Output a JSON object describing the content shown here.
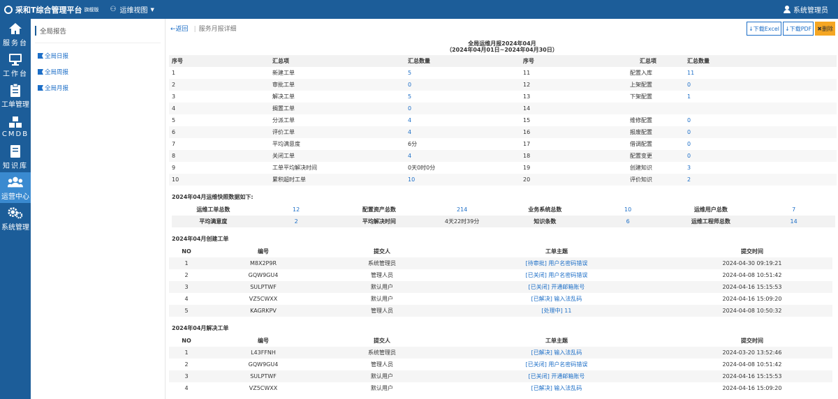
{
  "header": {
    "logo": "采和T综合管理平台",
    "logo_sub": "旗舰版",
    "view": "运维视图",
    "user": "系统管理员",
    "colors": {
      "primary": "#1c5d99",
      "active": "#3a8ad0",
      "link": "#1c6ec7",
      "delete": "#f5a623"
    }
  },
  "nav": [
    {
      "label": "服务台",
      "icon": "home-icon"
    },
    {
      "label": "工作台",
      "icon": "monitor-icon"
    },
    {
      "label": "工单管理",
      "icon": "clipboard-icon"
    },
    {
      "label": "CMDB",
      "icon": "cubes-icon"
    },
    {
      "label": "知识库",
      "icon": "book-icon"
    },
    {
      "label": "运营中心",
      "icon": "users-icon",
      "active": true
    },
    {
      "label": "系统管理",
      "icon": "gears-icon"
    }
  ],
  "sidebar": {
    "title": "全局报告",
    "items": [
      {
        "label": "全局日报"
      },
      {
        "label": "全局周报"
      },
      {
        "label": "全局月报"
      }
    ]
  },
  "toolbar": {
    "back": "返回",
    "crumb": "服务月报详细",
    "excel": "下载Excel",
    "pdf": "下载PDF",
    "delete": "删除"
  },
  "report": {
    "title": "全局运维月报2024年04月",
    "range": "（2024年04月01日~2024年04月30日）"
  },
  "summary": {
    "headers": [
      "序号",
      "汇总项",
      "汇总数量",
      "序号",
      "汇总项",
      "汇总数量"
    ],
    "rows": [
      [
        "1",
        "新建工单",
        "5",
        "11",
        "配置入库",
        "11"
      ],
      [
        "2",
        "审批工单",
        "0",
        "12",
        "上架配置",
        "0"
      ],
      [
        "3",
        "解决工单",
        "5",
        "13",
        "下架配置",
        "1"
      ],
      [
        "4",
        "搁置工单",
        "0",
        "14",
        "",
        ""
      ],
      [
        "5",
        "分派工单",
        "4",
        "15",
        "维修配置",
        "0"
      ],
      [
        "6",
        "评价工单",
        "4",
        "16",
        "报废配置",
        "0"
      ],
      [
        "7",
        "平均满意度",
        "6分",
        "17",
        "借调配置",
        "0"
      ],
      [
        "8",
        "关闭工单",
        "4",
        "18",
        "配置变更",
        "0"
      ],
      [
        "9",
        "工单平均解决时间",
        "0天0时0分",
        "19",
        "创建知识",
        "3"
      ],
      [
        "10",
        "累积超时工单",
        "10",
        "20",
        "评价知识",
        "2"
      ]
    ]
  },
  "snapshot": {
    "title": "2024年04月运维快照数据如下:",
    "rows": [
      [
        {
          "l": "运维工单总数",
          "v": "12"
        },
        {
          "l": "配置资产总数",
          "v": "214"
        },
        {
          "l": "业务系统总数",
          "v": "10"
        },
        {
          "l": "运维用户总数",
          "v": "7"
        }
      ],
      [
        {
          "l": "平均满意度",
          "v": "2"
        },
        {
          "l": "平均解决时间",
          "v": "4天22时39分"
        },
        {
          "l": "知识条数",
          "v": "6"
        },
        {
          "l": "运维工程师总数",
          "v": "14"
        }
      ]
    ]
  },
  "created": {
    "title": "2024年04月创建工单",
    "headers": [
      "NO",
      "编号",
      "提交人",
      "工单主题",
      "提交时间"
    ],
    "rows": [
      [
        "1",
        "M8X2P9R",
        "系统管理员",
        "[待审批] 用户名密码错误",
        "2024-04-30 09:19:21"
      ],
      [
        "2",
        "GQW9GU4",
        "管理人员",
        "[已关闭] 用户名密码错误",
        "2024-04-08 10:51:42"
      ],
      [
        "3",
        "SULPTWF",
        "默认用户",
        "[已关闭] 开通邮箱账号",
        "2024-04-16 15:15:53"
      ],
      [
        "4",
        "VZ5CWXX",
        "默认用户",
        "[已解决] 输入法乱码",
        "2024-04-16 15:09:20"
      ],
      [
        "5",
        "KAGRKPV",
        "管理人员",
        "[处理中] 11",
        "2024-04-08 10:50:32"
      ]
    ]
  },
  "resolved": {
    "title": "2024年04月解决工单",
    "headers": [
      "NO",
      "编号",
      "提交人",
      "工单主题",
      "提交时间"
    ],
    "rows": [
      [
        "1",
        "L43FFNH",
        "系统管理员",
        "[已解决] 输入法乱码",
        "2024-03-20 13:52:46"
      ],
      [
        "2",
        "GQW9GU4",
        "管理人员",
        "[已关闭] 用户名密码错误",
        "2024-04-08 10:51:42"
      ],
      [
        "3",
        "SULPTWF",
        "默认用户",
        "[已关闭] 开通邮箱账号",
        "2024-04-16 15:15:53"
      ],
      [
        "4",
        "VZ5CWXX",
        "默认用户",
        "[已解决] 输入法乱码",
        "2024-04-16 15:09:20"
      ]
    ]
  }
}
